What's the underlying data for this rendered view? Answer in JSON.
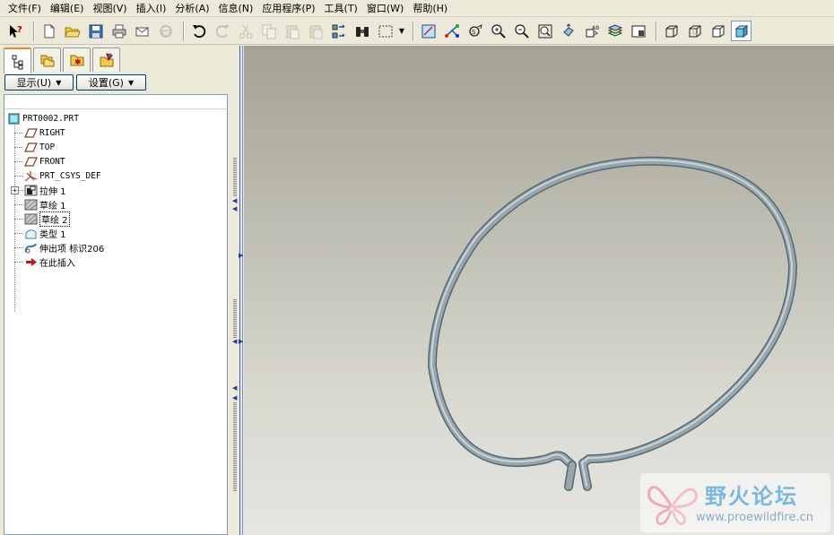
{
  "menu": [
    "文件(F)",
    "编辑(E)",
    "视图(V)",
    "插入(I)",
    "分析(A)",
    "信息(N)",
    "应用程序(P)",
    "工具(T)",
    "窗口(W)",
    "帮助(H)"
  ],
  "panel": {
    "show_label": "显示(U)",
    "settings_label": "设置(G)"
  },
  "tree": {
    "root": "PRT0002.PRT",
    "items": [
      {
        "label": "RIGHT",
        "icon": "datum-plane-icon"
      },
      {
        "label": "TOP",
        "icon": "datum-plane-icon"
      },
      {
        "label": "FRONT",
        "icon": "datum-plane-icon"
      },
      {
        "label": "PRT_CSYS_DEF",
        "icon": "csys-icon"
      },
      {
        "label": "拉伸 1",
        "icon": "extrude-icon"
      },
      {
        "label": "草绘 1",
        "icon": "sketch-icon"
      },
      {
        "label": "草绘 2",
        "icon": "sketch-icon"
      },
      {
        "label": "类型 1",
        "icon": "type-feature-icon"
      },
      {
        "label": "伸出项 标识206",
        "icon": "protrusion-icon"
      },
      {
        "label": "在此插入",
        "icon": "insert-here-arrow-icon"
      }
    ]
  },
  "watermark": {
    "title": "野火论坛",
    "url": "www.proewildfire.cn"
  },
  "colors": {
    "tube": "#8f9ea6",
    "selection_accent": "#e68b2c"
  }
}
